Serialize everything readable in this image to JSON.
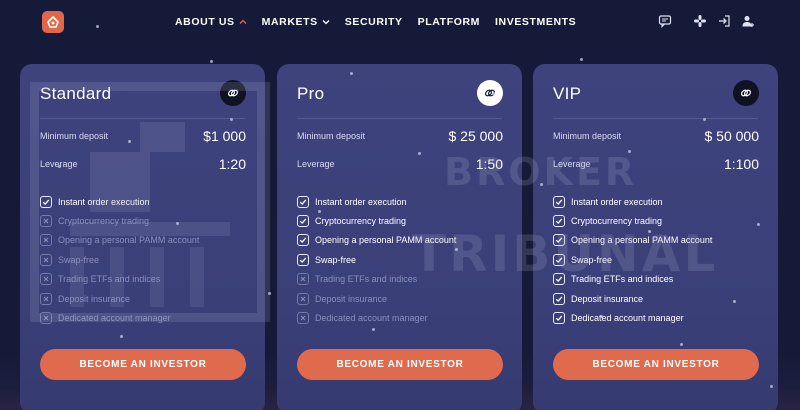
{
  "nav": {
    "items": [
      {
        "label": "ABOUT US",
        "active": true,
        "has_dropdown": true
      },
      {
        "label": "MARKETS",
        "active": false,
        "has_dropdown": true
      },
      {
        "label": "SECURITY",
        "active": false,
        "has_dropdown": false
      },
      {
        "label": "PLATFORM",
        "active": false,
        "has_dropdown": false
      },
      {
        "label": "INVESTMENTS",
        "active": false,
        "has_dropdown": false
      }
    ],
    "right_icons": [
      "chat-icon",
      "slack-icon",
      "login-icon",
      "user-add-icon"
    ]
  },
  "plans": [
    {
      "name": "Standard",
      "icon": "link-icon",
      "min_deposit_label": "Minimum deposit",
      "min_deposit": "$1 000",
      "leverage_label": "Leverage",
      "leverage": "1:20",
      "features": [
        {
          "label": "Instant order execution",
          "included": true
        },
        {
          "label": "Cryptocurrency trading",
          "included": false
        },
        {
          "label": "Opening a personal PAMM account",
          "included": false
        },
        {
          "label": "Swap-free",
          "included": false
        },
        {
          "label": "Trading ETFs and indices",
          "included": false
        },
        {
          "label": "Deposit insurance",
          "included": false
        },
        {
          "label": "Dedicated account manager",
          "included": false
        }
      ],
      "button": "BECOME AN INVESTOR"
    },
    {
      "name": "Pro",
      "icon": "link-icon",
      "min_deposit_label": "Minimum deposit",
      "min_deposit": "$ 25 000",
      "leverage_label": "Leverage",
      "leverage": "1:50",
      "features": [
        {
          "label": "Instant order execution",
          "included": true
        },
        {
          "label": "Cryptocurrency trading",
          "included": true
        },
        {
          "label": "Opening a personal PAMM account",
          "included": true
        },
        {
          "label": "Swap-free",
          "included": true
        },
        {
          "label": "Trading ETFs and indices",
          "included": false
        },
        {
          "label": "Deposit insurance",
          "included": false
        },
        {
          "label": "Dedicated account manager",
          "included": false
        }
      ],
      "button": "BECOME AN INVESTOR"
    },
    {
      "name": "VIP",
      "icon": "link-icon",
      "min_deposit_label": "Minimum deposit",
      "min_deposit": "$ 50 000",
      "leverage_label": "Leverage",
      "leverage": "1:100",
      "features": [
        {
          "label": "Instant order execution",
          "included": true
        },
        {
          "label": "Cryptocurrency trading",
          "included": true
        },
        {
          "label": "Opening a personal PAMM account",
          "included": true
        },
        {
          "label": "Swap-free",
          "included": true
        },
        {
          "label": "Trading ETFs and indices",
          "included": true
        },
        {
          "label": "Deposit insurance",
          "included": true
        },
        {
          "label": "Dedicated account manager",
          "included": true
        }
      ],
      "button": "BECOME AN INVESTOR"
    }
  ],
  "watermark": {
    "line1": "BROKER",
    "line2": "TRIBUNAL"
  },
  "colors": {
    "accent": "#e06a4d",
    "nav_active": "#e8664a",
    "card_bg": "#3e437d",
    "page_bg": "#141a38"
  }
}
